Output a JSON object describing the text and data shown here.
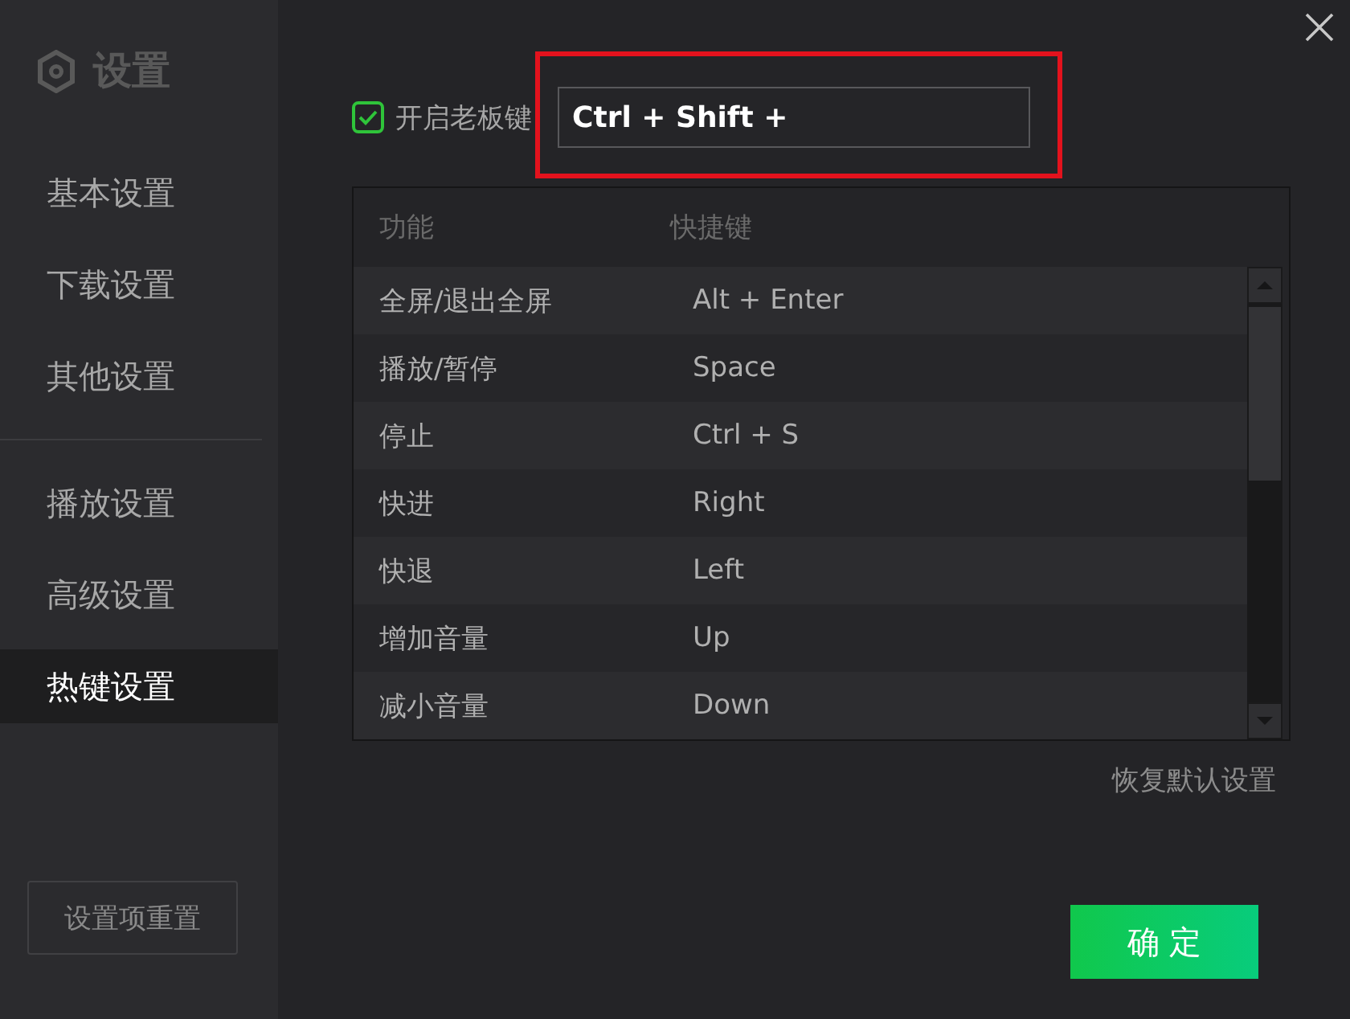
{
  "sidebar": {
    "title": "设置",
    "sections": [
      {
        "items": [
          {
            "label": "基本设置",
            "selected": false
          },
          {
            "label": "下载设置",
            "selected": false
          },
          {
            "label": "其他设置",
            "selected": false
          }
        ]
      },
      {
        "items": [
          {
            "label": "播放设置",
            "selected": false
          },
          {
            "label": "高级设置",
            "selected": false
          },
          {
            "label": "热键设置",
            "selected": true
          }
        ]
      }
    ],
    "reset_button": "设置项重置"
  },
  "boss_key": {
    "label": "开启老板键",
    "checked": true,
    "value": "Ctrl + Shift +",
    "highlighted": true
  },
  "hotkey_table": {
    "columns": [
      "功能",
      "快捷键"
    ],
    "rows": [
      {
        "function": "全屏/退出全屏",
        "shortcut": "Alt + Enter"
      },
      {
        "function": "播放/暂停",
        "shortcut": "Space"
      },
      {
        "function": "停止",
        "shortcut": "Ctrl + S"
      },
      {
        "function": "快进",
        "shortcut": "Right"
      },
      {
        "function": "快退",
        "shortcut": "Left"
      },
      {
        "function": "增加音量",
        "shortcut": "Up"
      },
      {
        "function": "减小音量",
        "shortcut": "Down"
      }
    ]
  },
  "restore_defaults_link": "恢复默认设置",
  "confirm_button": "确定"
}
